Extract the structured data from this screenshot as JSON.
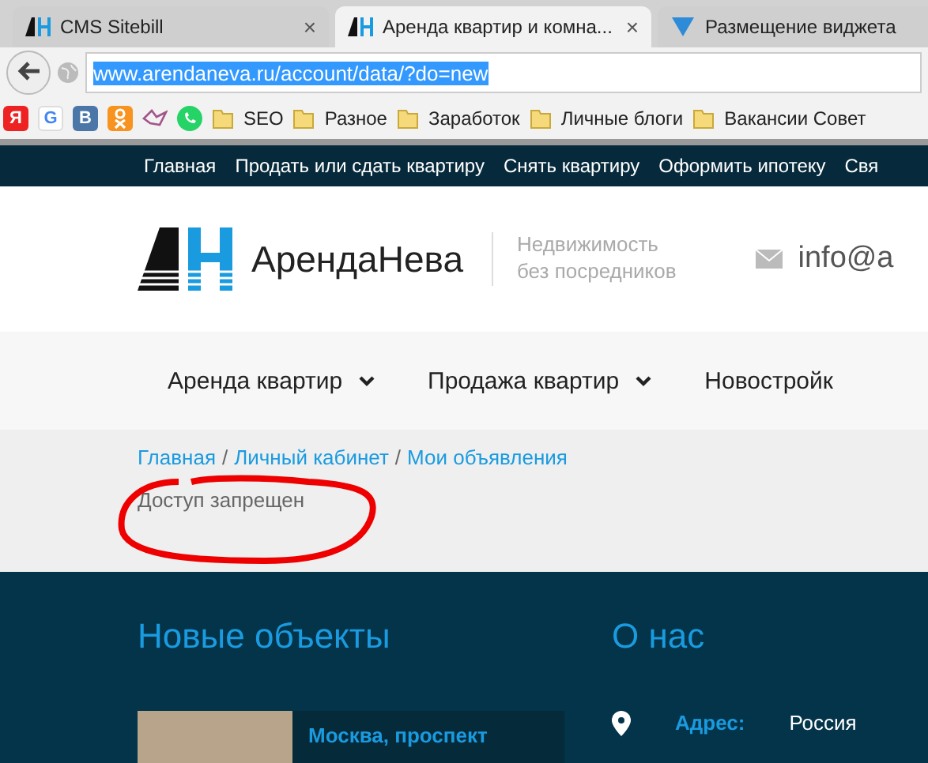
{
  "browser": {
    "tabs": [
      {
        "title": "CMS Sitebill",
        "selected": false,
        "close": "×"
      },
      {
        "title": "Аренда квартир и комна...",
        "selected": true,
        "close": "×"
      },
      {
        "title": "Размещение виджета",
        "selected": false
      }
    ],
    "address": "www.arendaneva.ru/account/data/?do=new",
    "bookmarks": [
      {
        "kind": "yandex",
        "label": "Я"
      },
      {
        "kind": "google",
        "label": "G"
      },
      {
        "kind": "vk",
        "label": "В"
      },
      {
        "kind": "ok"
      },
      {
        "kind": "bird"
      },
      {
        "kind": "whatsapp"
      },
      {
        "kind": "folder",
        "label": "SEO"
      },
      {
        "kind": "folder",
        "label": "Разное"
      },
      {
        "kind": "folder",
        "label": "Заработок"
      },
      {
        "kind": "folder",
        "label": "Личные блоги"
      },
      {
        "kind": "folder",
        "label": "Вакансии Совет"
      }
    ]
  },
  "top_menu": [
    "Главная",
    "Продать или сдать квартиру",
    "Снять квартиру",
    "Оформить ипотеку",
    "Свя"
  ],
  "header": {
    "brand": "АрендаНева",
    "tagline": [
      "Недвижимость",
      "без посредников"
    ],
    "email": "info@a"
  },
  "main_menu": [
    {
      "label": "Аренда квартир",
      "dropdown": true
    },
    {
      "label": "Продажа квартир",
      "dropdown": true
    },
    {
      "label": "Новостройк",
      "dropdown": false
    }
  ],
  "breadcrumbs": [
    {
      "kind": "link",
      "text": "Главная"
    },
    {
      "kind": "separator",
      "text": "/"
    },
    {
      "kind": "link",
      "text": "Личный кабинет"
    },
    {
      "kind": "separator",
      "text": "/"
    },
    {
      "kind": "link",
      "text": "Мои объявления"
    }
  ],
  "message": "Доступ запрещен",
  "footer": {
    "new_objects": {
      "title": "Новые объекты",
      "items": [
        {
          "title": "Москва, проспект"
        }
      ]
    },
    "about": {
      "title": "О нас",
      "address_label": "Адрес:",
      "address": "Россия"
    }
  }
}
